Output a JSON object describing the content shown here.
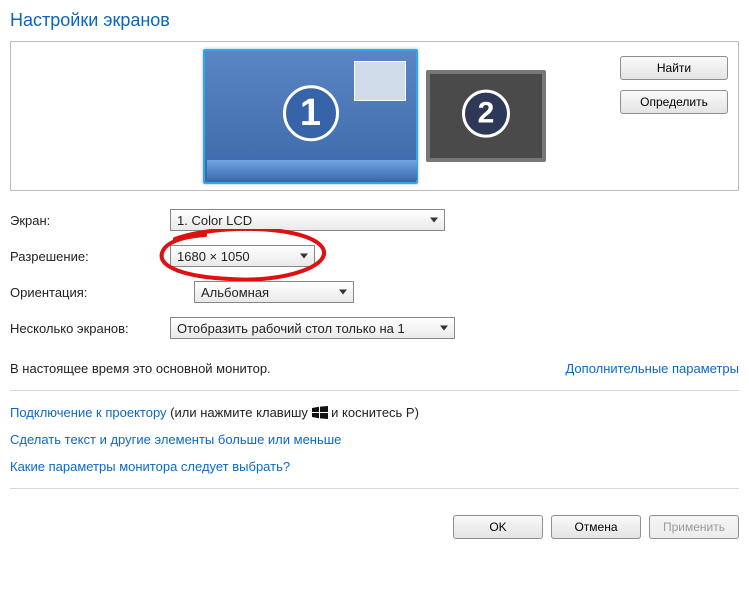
{
  "title": "Настройки экранов",
  "buttons": {
    "find": "Найти",
    "identify": "Определить",
    "ok": "OK",
    "cancel": "Отмена",
    "apply": "Применить"
  },
  "monitors": {
    "m1": "1",
    "m2": "2"
  },
  "labels": {
    "screen": "Экран:",
    "resolution": "Разрешение:",
    "orientation": "Ориентация:",
    "multiple": "Несколько экранов:"
  },
  "values": {
    "screen": "1. Color LCD",
    "resolution": "1680 × 1050",
    "orientation": "Альбомная",
    "multiple": "Отобразить рабочий стол только на 1"
  },
  "info": {
    "primary": "В настоящее время это основной монитор.",
    "advanced": "Дополнительные параметры"
  },
  "links": {
    "projector_link": "Подключение к проектору",
    "projector_tail": " (или нажмите клавишу ",
    "projector_tail2": " и коснитесь P)",
    "bigger": "Сделать текст и другие элементы больше или меньше",
    "which": "Какие параметры монитора следует выбрать?"
  }
}
